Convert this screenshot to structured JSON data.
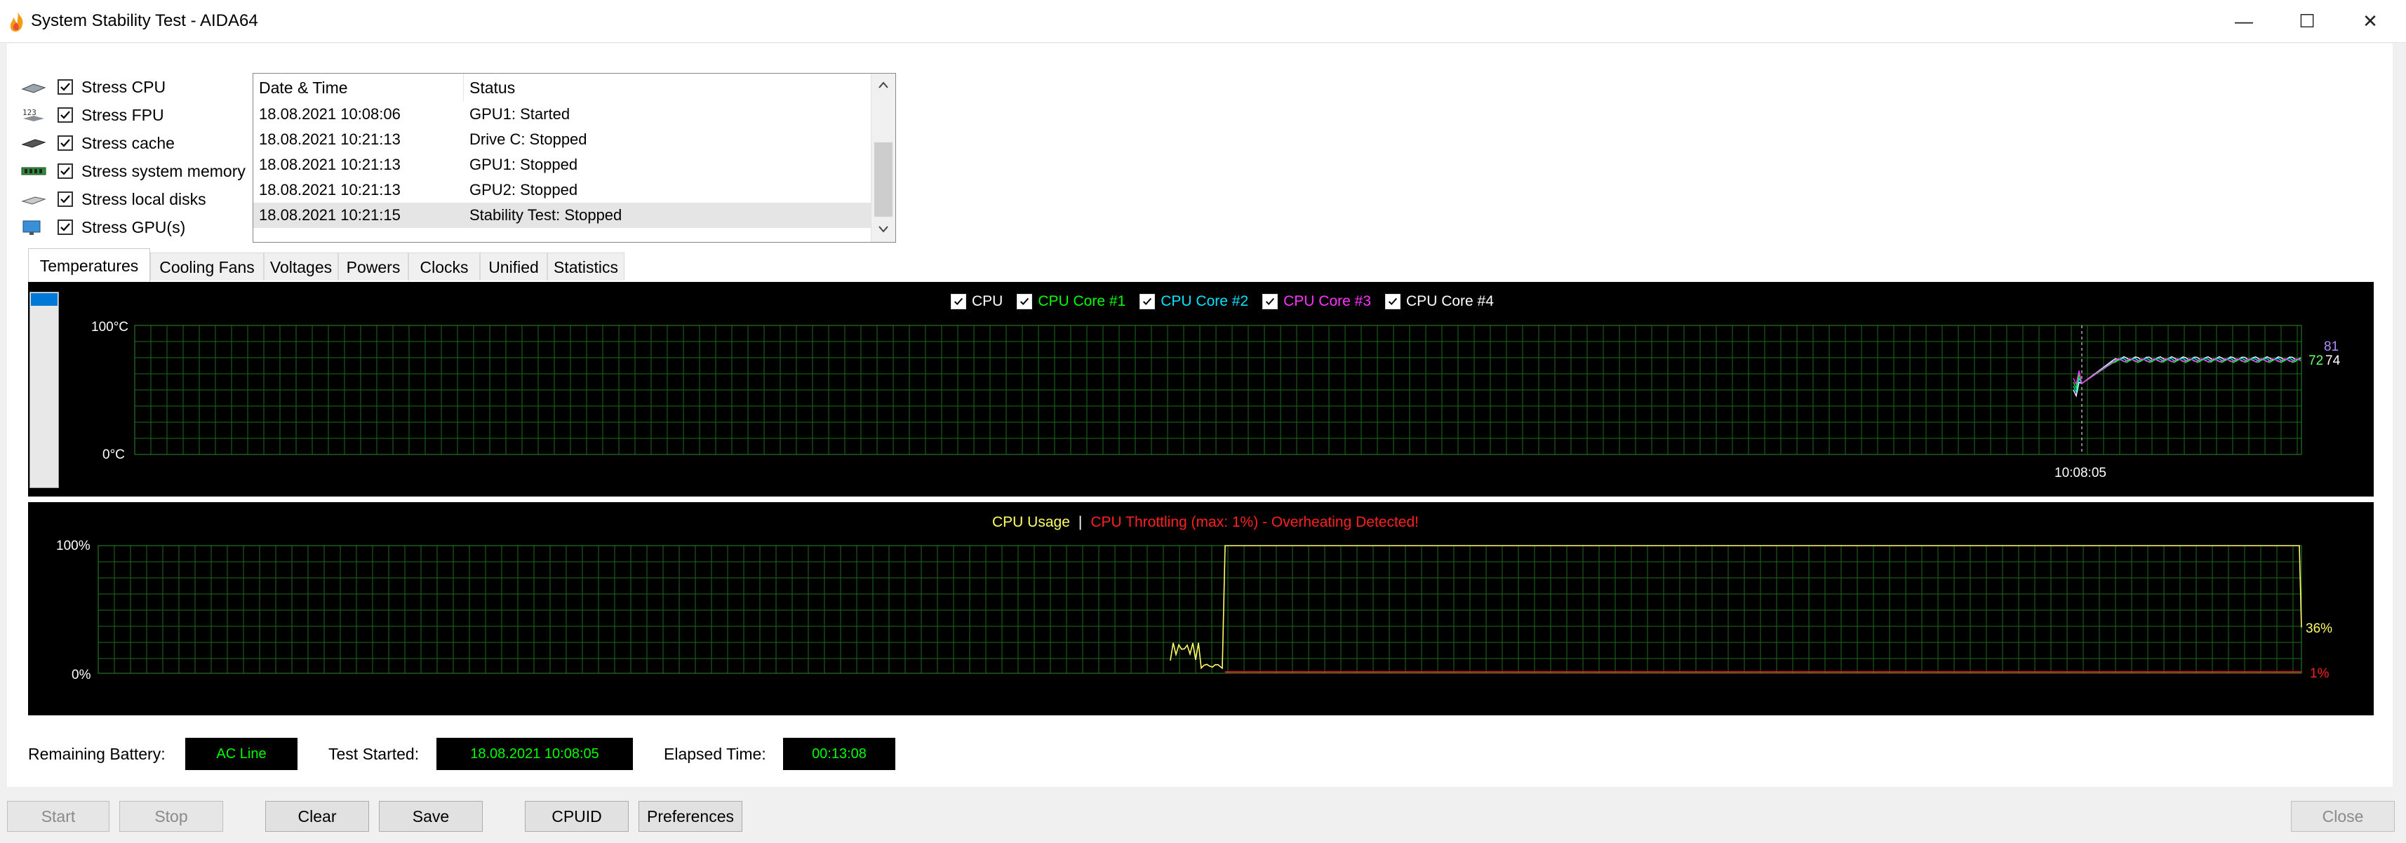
{
  "window": {
    "title": "System Stability Test - AIDA64",
    "controls": {
      "minimize": "—",
      "maximize": "☐",
      "close": "✕"
    }
  },
  "stress_options": [
    {
      "label": "Stress CPU",
      "checked": true,
      "icon": "cpu-icon"
    },
    {
      "label": "Stress FPU",
      "checked": true,
      "icon": "fpu-icon"
    },
    {
      "label": "Stress cache",
      "checked": true,
      "icon": "cache-icon"
    },
    {
      "label": "Stress system memory",
      "checked": true,
      "icon": "memory-icon"
    },
    {
      "label": "Stress local disks",
      "checked": true,
      "icon": "disk-icon"
    },
    {
      "label": "Stress GPU(s)",
      "checked": true,
      "icon": "gpu-icon"
    }
  ],
  "log": {
    "columns": [
      "Date & Time",
      "Status"
    ],
    "rows": [
      {
        "time": "18.08.2021 10:08:06",
        "status": "GPU1: Started"
      },
      {
        "time": "18.08.2021 10:21:13",
        "status": "Drive C: Stopped"
      },
      {
        "time": "18.08.2021 10:21:13",
        "status": "GPU1: Stopped"
      },
      {
        "time": "18.08.2021 10:21:13",
        "status": "GPU2: Stopped"
      },
      {
        "time": "18.08.2021 10:21:15",
        "status": "Stability Test: Stopped"
      }
    ],
    "selected_row": 4
  },
  "tabs": [
    "Temperatures",
    "Cooling Fans",
    "Voltages",
    "Powers",
    "Clocks",
    "Unified",
    "Statistics"
  ],
  "active_tab": 0,
  "temperature_chart": {
    "legend": [
      {
        "label": "CPU",
        "color": "#ffffff",
        "checked": true
      },
      {
        "label": "CPU Core #1",
        "color": "#00ff00",
        "checked": true
      },
      {
        "label": "CPU Core #2",
        "color": "#00e5ff",
        "checked": true
      },
      {
        "label": "CPU Core #3",
        "color": "#ff33ff",
        "checked": true
      },
      {
        "label": "CPU Core #4",
        "color": "#ffffff",
        "checked": true
      }
    ],
    "y_max_label": "100°C",
    "y_min_label": "0°C",
    "time_marker": "10:08:05",
    "end_values": [
      "81",
      "72",
      "74"
    ],
    "end_value_colors": [
      "#b38cff",
      "#66ff66",
      "#ffffff"
    ]
  },
  "usage_chart": {
    "title_usage": "CPU Usage",
    "title_separator": "|",
    "title_throttle": "CPU Throttling (max: 1%) - Overheating Detected!",
    "y_max_label": "100%",
    "y_min_label": "0%",
    "usage_end_value": "36%",
    "throttle_end_value": "1%",
    "usage_color": "#ffff66",
    "throttle_color": "#ff2020"
  },
  "status": {
    "battery_label": "Remaining Battery:",
    "battery_value": "AC Line",
    "started_label": "Test Started:",
    "started_value": "18.08.2021 10:08:05",
    "elapsed_label": "Elapsed Time:",
    "elapsed_value": "00:13:08"
  },
  "buttons": {
    "start": "Start",
    "stop": "Stop",
    "clear": "Clear",
    "save": "Save",
    "cpuid": "CPUID",
    "preferences": "Preferences",
    "close": "Close"
  }
}
